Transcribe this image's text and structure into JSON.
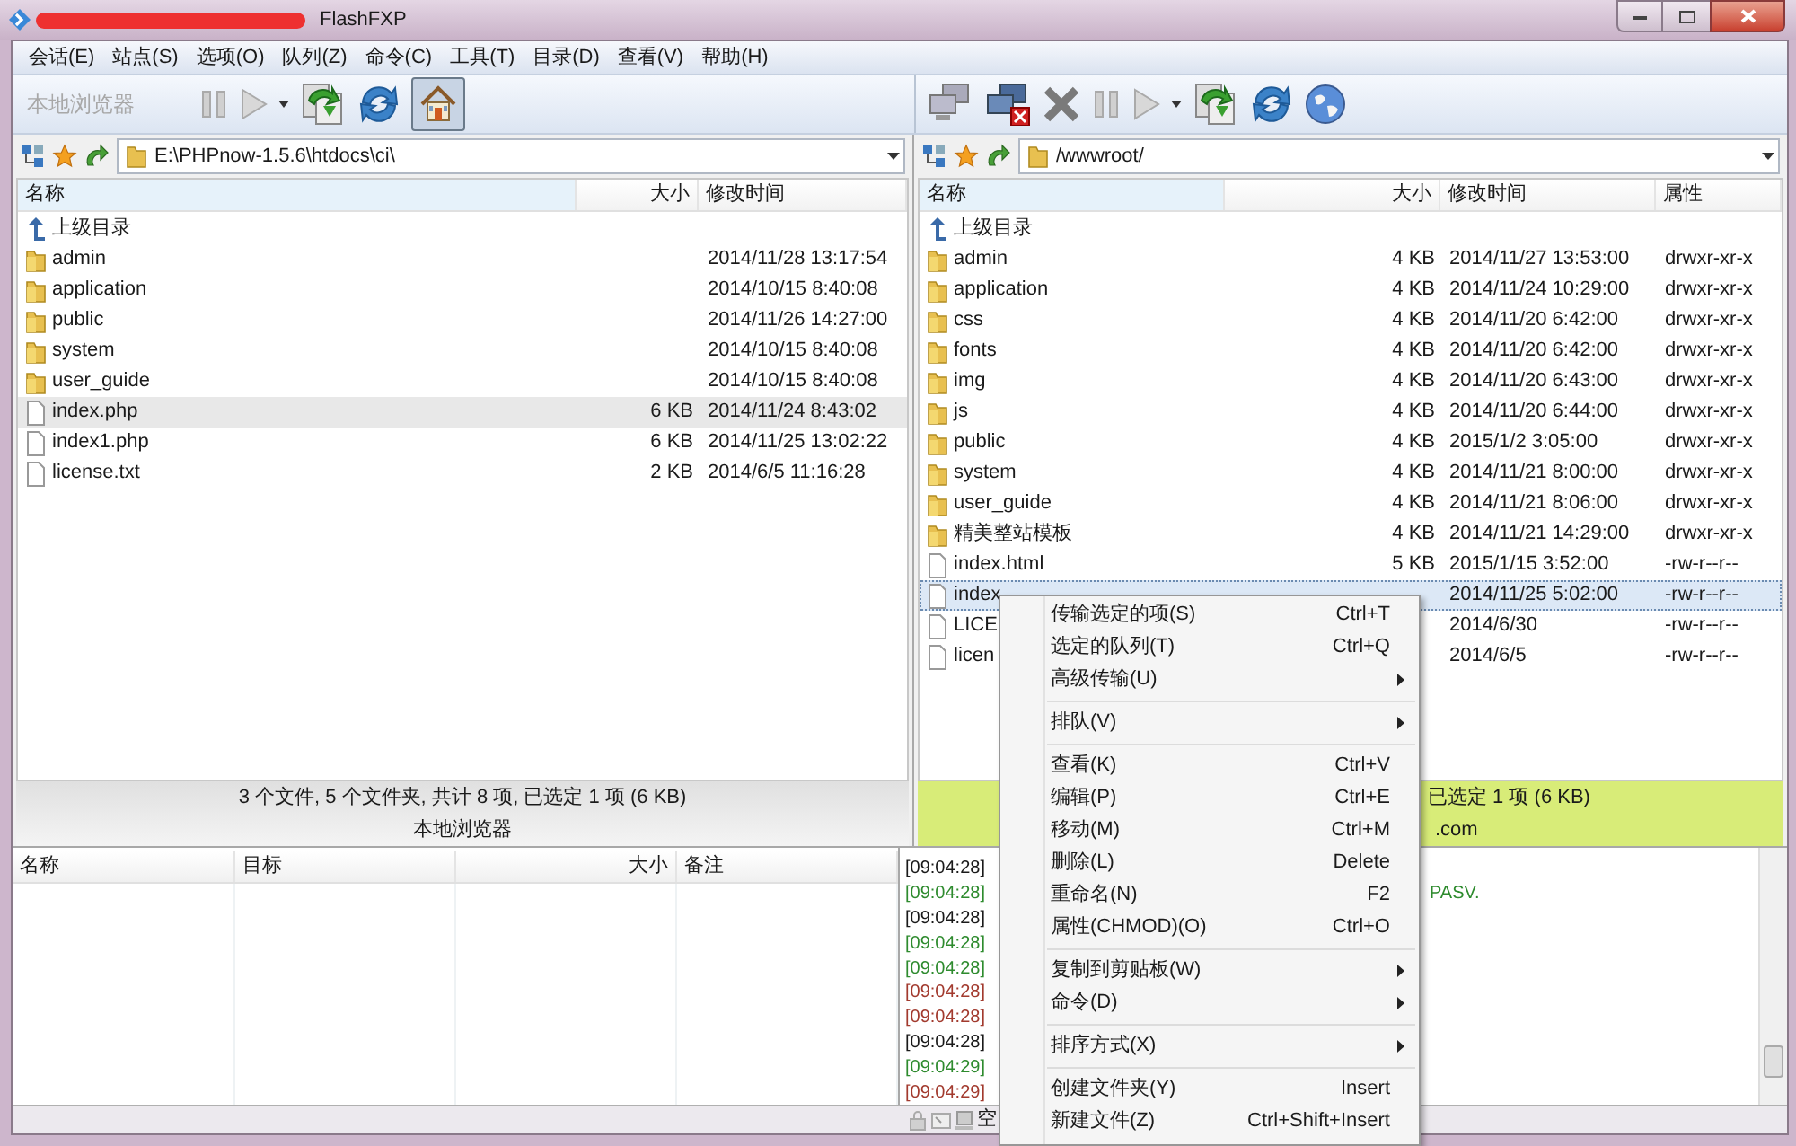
{
  "window": {
    "title": "FlashFXP"
  },
  "menu": [
    "会话(E)",
    "站点(S)",
    "选项(O)",
    "队列(Z)",
    "命令(C)",
    "工具(T)",
    "目录(D)",
    "查看(V)",
    "帮助(H)"
  ],
  "left_toolbar": {
    "label": "本地浏览器"
  },
  "left": {
    "path": "E:\\PHPnow-1.5.6\\htdocs\\ci\\",
    "columns": [
      "名称",
      "大小",
      "修改时间"
    ],
    "rows": [
      {
        "kind": "up",
        "name": "上级目录",
        "selected": false
      },
      {
        "kind": "folder",
        "name": "admin",
        "time": "2014/11/28 13:17:54",
        "selected": false
      },
      {
        "kind": "folder",
        "name": "application",
        "time": "2014/10/15 8:40:08",
        "selected": false
      },
      {
        "kind": "folder",
        "name": "public",
        "time": "2014/11/26 14:27:00",
        "selected": false
      },
      {
        "kind": "folder",
        "name": "system",
        "time": "2014/10/15 8:40:08",
        "selected": false
      },
      {
        "kind": "folder",
        "name": "user_guide",
        "time": "2014/10/15 8:40:08",
        "selected": false
      },
      {
        "kind": "file",
        "name": "index.php",
        "size": "6 KB",
        "time": "2014/11/24 8:43:02",
        "selected": true
      },
      {
        "kind": "file",
        "name": "index1.php",
        "size": "6 KB",
        "time": "2014/11/25 13:02:22",
        "selected": false
      },
      {
        "kind": "file",
        "name": "license.txt",
        "size": "2 KB",
        "time": "2014/6/5 11:16:28",
        "selected": false
      }
    ],
    "status": "3 个文件, 5 个文件夹, 共计 8 项, 已选定 1 项 (6 KB)",
    "caption": "本地浏览器"
  },
  "right": {
    "path": "/wwwroot/",
    "columns": [
      "名称",
      "大小",
      "修改时间",
      "属性"
    ],
    "rows": [
      {
        "kind": "up",
        "name": "上级目录",
        "selected": false
      },
      {
        "kind": "folder",
        "name": "admin",
        "size": "4 KB",
        "time": "2014/11/27 13:53:00",
        "attr": "drwxr-xr-x",
        "selected": false
      },
      {
        "kind": "folder",
        "name": "application",
        "size": "4 KB",
        "time": "2014/11/24 10:29:00",
        "attr": "drwxr-xr-x",
        "selected": false
      },
      {
        "kind": "folder",
        "name": "css",
        "size": "4 KB",
        "time": "2014/11/20 6:42:00",
        "attr": "drwxr-xr-x",
        "selected": false
      },
      {
        "kind": "folder",
        "name": "fonts",
        "size": "4 KB",
        "time": "2014/11/20 6:42:00",
        "attr": "drwxr-xr-x",
        "selected": false
      },
      {
        "kind": "folder",
        "name": "img",
        "size": "4 KB",
        "time": "2014/11/20 6:43:00",
        "attr": "drwxr-xr-x",
        "selected": false
      },
      {
        "kind": "folder",
        "name": "js",
        "size": "4 KB",
        "time": "2014/11/20 6:44:00",
        "attr": "drwxr-xr-x",
        "selected": false
      },
      {
        "kind": "folder",
        "name": "public",
        "size": "4 KB",
        "time": "2015/1/2 3:05:00",
        "attr": "drwxr-xr-x",
        "selected": false
      },
      {
        "kind": "folder",
        "name": "system",
        "size": "4 KB",
        "time": "2014/11/21 8:00:00",
        "attr": "drwxr-xr-x",
        "selected": false
      },
      {
        "kind": "folder",
        "name": "user_guide",
        "size": "4 KB",
        "time": "2014/11/21 8:06:00",
        "attr": "drwxr-xr-x",
        "selected": false
      },
      {
        "kind": "folder",
        "name": "精美整站模板",
        "size": "4 KB",
        "time": "2014/11/21 14:29:00",
        "attr": "drwxr-xr-x",
        "selected": false
      },
      {
        "kind": "file",
        "name": "index.html",
        "size": "5 KB",
        "time": "2015/1/15 3:52:00",
        "attr": "-rw-r--r--",
        "selected": false
      },
      {
        "kind": "file",
        "name": "index",
        "time": "2014/11/25 5:02:00",
        "attr": "-rw-r--r--",
        "selected": true
      },
      {
        "kind": "file",
        "name": "LICE",
        "time": "2014/6/30",
        "attr": "-rw-r--r--",
        "selected": false
      },
      {
        "kind": "file",
        "name": "licen",
        "time": "2014/6/5",
        "attr": "-rw-r--r--",
        "selected": false
      }
    ],
    "status": "已选定 1 项 (6 KB)",
    "caption": ".com"
  },
  "queue": {
    "columns": [
      "名称",
      "目标",
      "大小",
      "备注"
    ]
  },
  "log": [
    {
      "text": "[09:04:28]",
      "color": "#1a1a1a"
    },
    {
      "text": "[09:04:28]",
      "color": "#2e8b2e",
      "tail": "PASV."
    },
    {
      "text": "[09:04:28]",
      "color": "#1a1a1a"
    },
    {
      "text": "[09:04:28]",
      "color": "#2e8b2e"
    },
    {
      "text": "[09:04:28]",
      "color": "#2e8b2e"
    },
    {
      "text": "[09:04:28]",
      "color": "#a23a2e"
    },
    {
      "text": "[09:04:28]",
      "color": "#a23a2e"
    },
    {
      "text": "[09:04:28]",
      "color": "#1a1a1a"
    },
    {
      "text": "[09:04:29]",
      "color": "#2e8b2e"
    },
    {
      "text": "[09:04:29]",
      "color": "#a23a2e"
    }
  ],
  "status_bar": {
    "text": "空"
  },
  "context_menu": [
    {
      "kind": "item",
      "label": "传输选定的项(S)",
      "shortcut": "Ctrl+T",
      "submenu": false
    },
    {
      "kind": "item",
      "label": "选定的队列(T)",
      "shortcut": "Ctrl+Q",
      "submenu": false
    },
    {
      "kind": "item",
      "label": "高级传输(U)",
      "submenu": true
    },
    {
      "kind": "separator"
    },
    {
      "kind": "item",
      "label": "排队(V)",
      "submenu": true
    },
    {
      "kind": "separator"
    },
    {
      "kind": "item",
      "label": "查看(K)",
      "shortcut": "Ctrl+V",
      "submenu": false
    },
    {
      "kind": "item",
      "label": "编辑(P)",
      "shortcut": "Ctrl+E",
      "submenu": false
    },
    {
      "kind": "item",
      "label": "移动(M)",
      "shortcut": "Ctrl+M",
      "submenu": false
    },
    {
      "kind": "item",
      "label": "删除(L)",
      "shortcut": "Delete",
      "submenu": false
    },
    {
      "kind": "item",
      "label": "重命名(N)",
      "shortcut": "F2",
      "submenu": false
    },
    {
      "kind": "item",
      "label": "属性(CHMOD)(O)",
      "shortcut": "Ctrl+O",
      "submenu": false
    },
    {
      "kind": "separator"
    },
    {
      "kind": "item",
      "label": "复制到剪贴板(W)",
      "submenu": true
    },
    {
      "kind": "item",
      "label": "命令(D)",
      "submenu": true
    },
    {
      "kind": "separator"
    },
    {
      "kind": "item",
      "label": "排序方式(X)",
      "submenu": true
    },
    {
      "kind": "separator"
    },
    {
      "kind": "item",
      "label": "创建文件夹(Y)",
      "shortcut": "Insert",
      "submenu": false
    },
    {
      "kind": "item",
      "label": "新建文件(Z)",
      "shortcut": "Ctrl+Shift+Insert",
      "submenu": false
    }
  ]
}
